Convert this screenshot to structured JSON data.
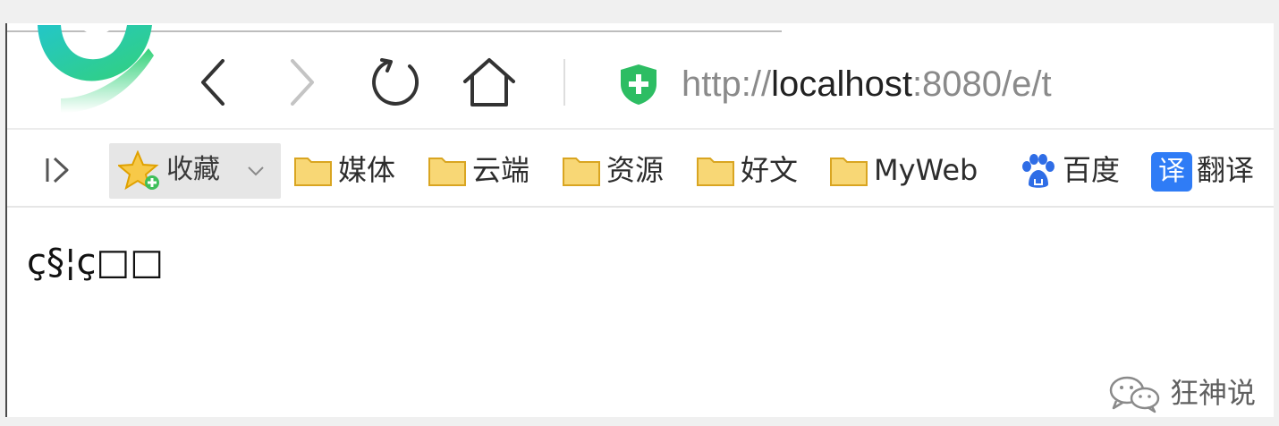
{
  "toolbar": {
    "address": {
      "scheme": "http://",
      "host": "localhost",
      "rest": ":8080/e/t"
    },
    "icons": [
      "back-icon",
      "forward-icon",
      "reload-icon",
      "home-icon",
      "security-shield-icon"
    ]
  },
  "bookmarks_bar": {
    "favorites_label": "收藏",
    "items": [
      {
        "label": "媒体",
        "icon": "folder-icon"
      },
      {
        "label": "云端",
        "icon": "folder-icon"
      },
      {
        "label": "资源",
        "icon": "folder-icon"
      },
      {
        "label": "好文",
        "icon": "folder-icon"
      },
      {
        "label": "MyWeb",
        "icon": "folder-icon"
      },
      {
        "label": "百度",
        "icon": "baidu-paw-icon"
      },
      {
        "label": "翻译",
        "icon": "translate-icon",
        "badge": "译"
      }
    ]
  },
  "page": {
    "body_text": "ç§¦ç□□"
  },
  "watermark": {
    "text": "狂神说"
  },
  "colors": {
    "accent_blue": "#2f7cf6",
    "shield_green": "#2dbd63",
    "folder_yellow": "#f8d775",
    "baidu_blue": "#2f6de6",
    "logo_green": "#33d17a",
    "logo_cyan": "#23c6c8"
  }
}
